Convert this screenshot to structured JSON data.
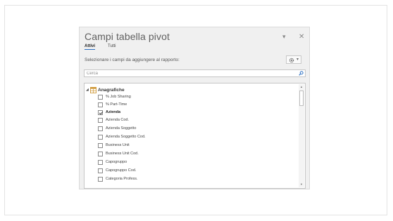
{
  "pane": {
    "title": "Campi tabella pivot",
    "tabs": {
      "active": "Attivi",
      "all": "Tutti"
    },
    "instruction": "Selezionare i campi da aggiungere al rapporto:",
    "search_placeholder": "Cerca",
    "group": {
      "label": "Anagrafiche",
      "expanded": true
    },
    "fields": [
      {
        "label": "% Job Sharing",
        "checked": false
      },
      {
        "label": "% Part-Time",
        "checked": false
      },
      {
        "label": "Azienda",
        "checked": true
      },
      {
        "label": "Azienda Cod.",
        "checked": false
      },
      {
        "label": "Azienda Soggetto",
        "checked": false
      },
      {
        "label": "Azienda Soggetto Cod.",
        "checked": false
      },
      {
        "label": "Business Unit",
        "checked": false
      },
      {
        "label": "Business Unit Cod.",
        "checked": false
      },
      {
        "label": "Capogruppo",
        "checked": false
      },
      {
        "label": "Capogruppo Cod.",
        "checked": false
      },
      {
        "label": "Categoria Profess.",
        "checked": false
      }
    ]
  },
  "icons": {
    "dropdown": "dropdown-caret-icon",
    "close": "close-icon",
    "settings": "gear-icon",
    "search": "search-icon",
    "table": "table-icon"
  },
  "colors": {
    "pane_background": "#f0f0f0",
    "tab_underline": "#2b6fc2",
    "table_icon": "#d09a3a"
  }
}
